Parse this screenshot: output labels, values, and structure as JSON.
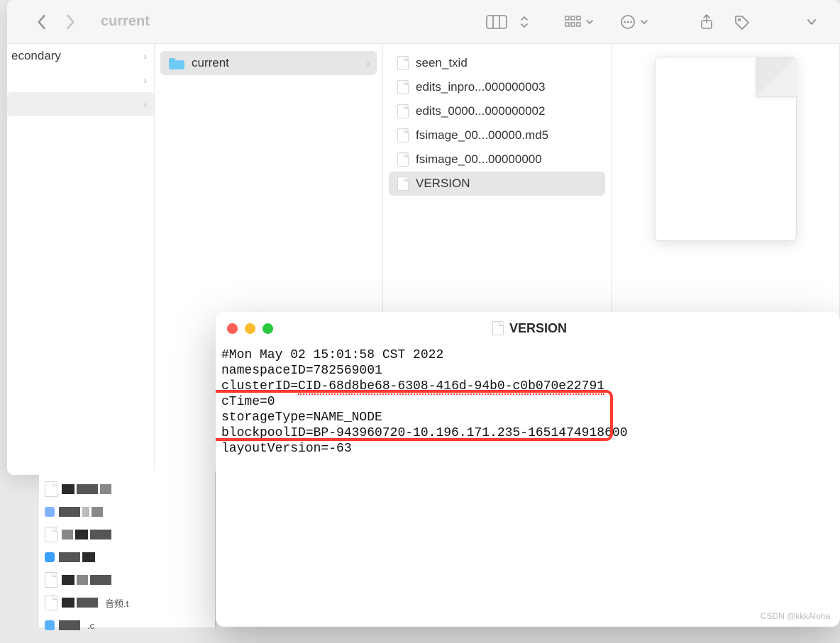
{
  "toolbar": {
    "title": "current"
  },
  "col1": {
    "items": [
      {
        "label": "econdary",
        "chev": "›"
      },
      {
        "label": "",
        "chev": "›"
      },
      {
        "label": "",
        "chev": "›"
      }
    ]
  },
  "col2": {
    "items": [
      {
        "label": "current",
        "selected": true,
        "folder": true,
        "chev": "›"
      }
    ]
  },
  "col3": {
    "items": [
      {
        "label": "seen_txid"
      },
      {
        "label": "edits_inpro...000000003"
      },
      {
        "label": "edits_0000...000000002"
      },
      {
        "label": "fsimage_00...00000.md5"
      },
      {
        "label": "fsimage_00...00000000"
      },
      {
        "label": "VERSION",
        "selected": true
      }
    ]
  },
  "editor": {
    "title": "VERSION",
    "lines": {
      "l1": "#Mon May 02 15:01:58 CST 2022",
      "l2": "namespaceID=782569001",
      "l3a": "clusterID=",
      "l3b": "CID-68d8be68-6308-416d-94b0-c0b070e22791",
      "l4": "cTime=0",
      "l5": "storageType=NAME_NODE",
      "l6": "blockpoolID=BP-943960720-10.196.171.235-1651474918600",
      "l7": "layoutVersion=-63"
    }
  },
  "thumbs": {
    "label1": "音频.t",
    "label2": ".c"
  },
  "watermark": "CSDN @kkkAloha"
}
